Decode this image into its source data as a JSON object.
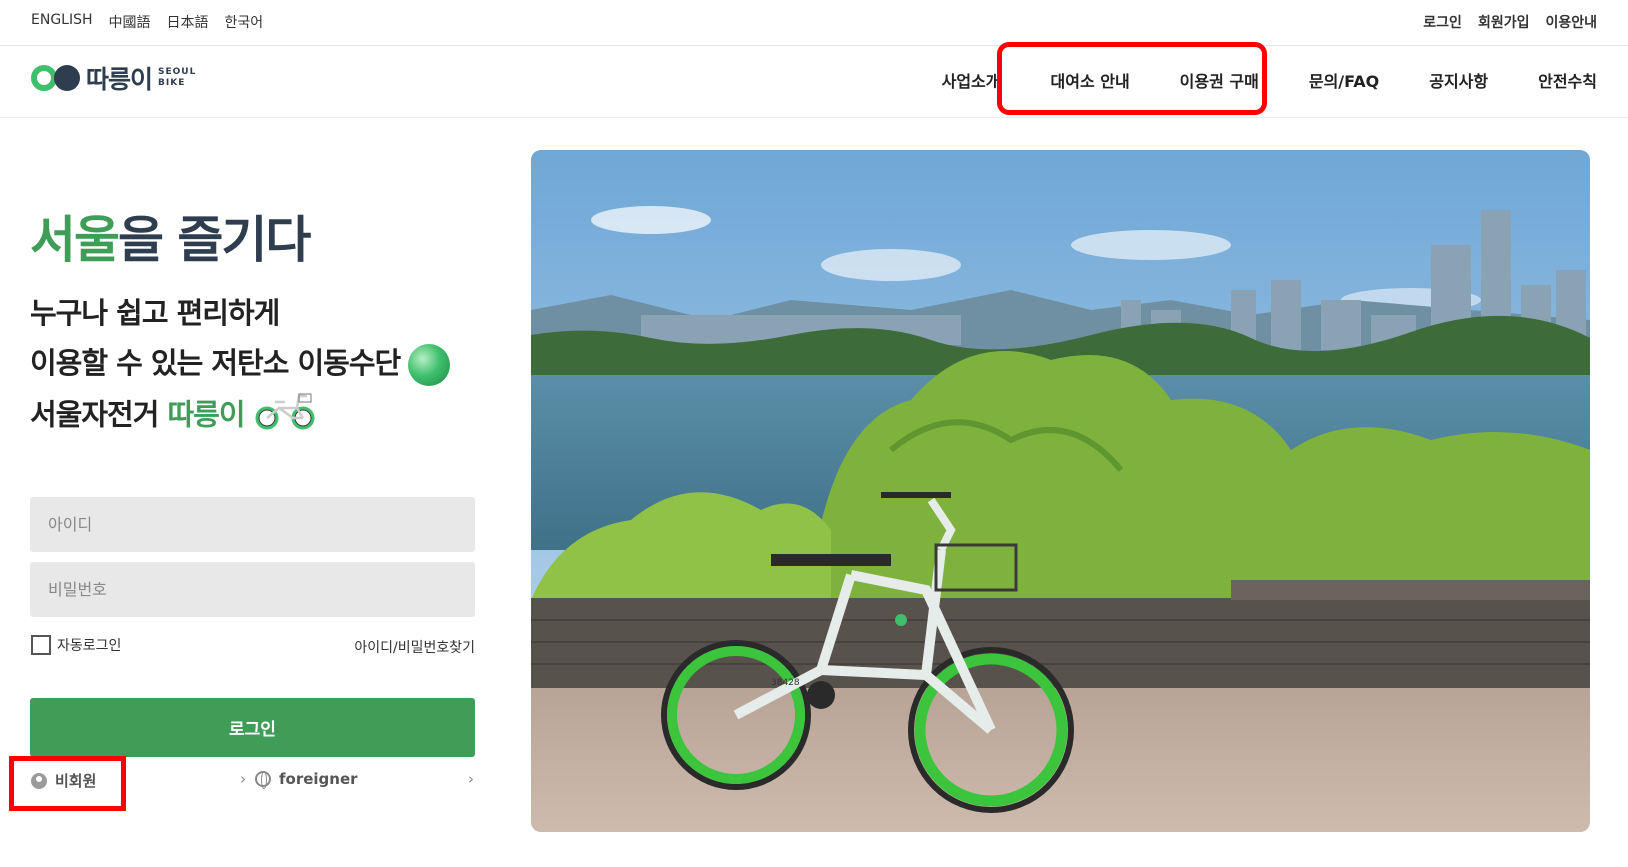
{
  "languages": [
    "ENGLISH",
    "中國語",
    "日本語",
    "한국어"
  ],
  "utility_links": [
    "로그인",
    "회원가입",
    "이용안내"
  ],
  "logo": {
    "word": "따릉이",
    "en_line1": "SEOUL",
    "en_line2": "BIKE"
  },
  "nav": [
    "사업소개",
    "대여소 안내",
    "이용권 구매",
    "문의/FAQ",
    "공지사항",
    "안전수칙"
  ],
  "hero": {
    "title_green": "서울",
    "title_rest": "을 즐기다",
    "line1": "누구나 쉽고 편리하게",
    "line2": "이용할 수 있는 저탄소 이동수단",
    "line3_prefix": "서울자전거 ",
    "line3_green": "따릉이"
  },
  "login": {
    "id_placeholder": "아이디",
    "pw_placeholder": "비밀번호",
    "auto_login": "자동로그인",
    "find_link": "아이디/비밀번호찾기",
    "button": "로그인",
    "nonmember": "비회원",
    "foreigner": "foreigner",
    "chevron": "›"
  },
  "photo": {
    "bike_number": "38428"
  },
  "colors": {
    "brand_green": "#3f9d58",
    "logo_green": "#3fbf6c",
    "logo_navy": "#2f3e4f",
    "highlight": "#ff0000"
  }
}
